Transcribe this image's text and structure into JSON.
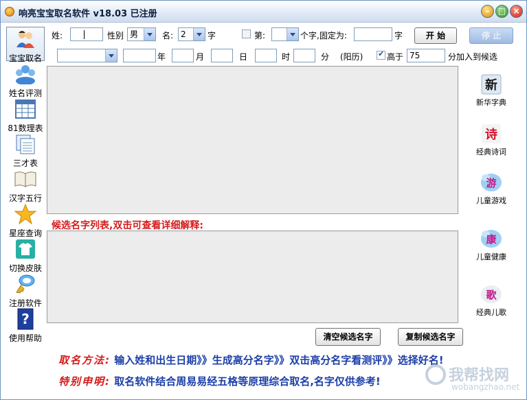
{
  "window": {
    "title": "响亮宝宝取名软件 v18.03   已注册"
  },
  "sidebar": {
    "items": [
      {
        "label": "宝宝取名",
        "icon": "people-icon"
      },
      {
        "label": "姓名评测",
        "icon": "user-group-icon"
      },
      {
        "label": "81数理表",
        "icon": "table-icon"
      },
      {
        "label": "三才表",
        "icon": "documents-icon"
      },
      {
        "label": "汉字五行",
        "icon": "book-icon"
      },
      {
        "label": "星座查询",
        "icon": "star-icon"
      },
      {
        "label": "切换皮肤",
        "icon": "shirt-icon"
      },
      {
        "label": "注册软件",
        "icon": "key-icon"
      },
      {
        "label": "使用帮助",
        "icon": "help-icon"
      }
    ]
  },
  "form": {
    "surname_label": "姓:",
    "surname_value": "",
    "gender_label": "性别",
    "gender_value": "男",
    "name_label": "名:",
    "name_length_value": "2",
    "name_unit": "字",
    "fixed_checkbox_label": "第:",
    "fixed_pos_value": "",
    "fixed_text": "个字,固定为:",
    "fixed_value": "",
    "fixed_unit": "字",
    "start_button": "开  始",
    "stop_button": "停  止",
    "year_label": "年",
    "month_label": "月",
    "day_label": "日",
    "hour_label": "时",
    "minute_label": "分",
    "calendar_label": "(阳历)",
    "higher_label": "高于",
    "higher_value": "75",
    "higher_suffix": "分加入到候选"
  },
  "lists": {
    "candidate_title": "候选名字列表,双击可查看详细解释:",
    "clear_button": "清空候选名字",
    "copy_button": "复制候选名字"
  },
  "right_menu": [
    {
      "label": "新华字典",
      "glyph": "新",
      "color": "#1a1a1a"
    },
    {
      "label": "经典诗词",
      "glyph": "诗",
      "color": "#d2142a"
    },
    {
      "label": "儿童游戏",
      "glyph": "游",
      "color": "#c8178a"
    },
    {
      "label": "儿童健康",
      "glyph": "康",
      "color": "#c8178a"
    },
    {
      "label": "经典儿歌",
      "glyph": "歌",
      "color": "#c8178a"
    }
  ],
  "notes": {
    "method_key": "取名方法:",
    "method_text": "输入姓和出生日期》》生成高分名字》》双击高分名字看测评》》选择好名!",
    "special_key": "特别申明:",
    "special_text": "取名软件结合周易易经五格等原理综合取名,名字仅供参考!"
  },
  "watermark": {
    "line1": "我帮找网",
    "line2": "wobangzhao.net"
  }
}
